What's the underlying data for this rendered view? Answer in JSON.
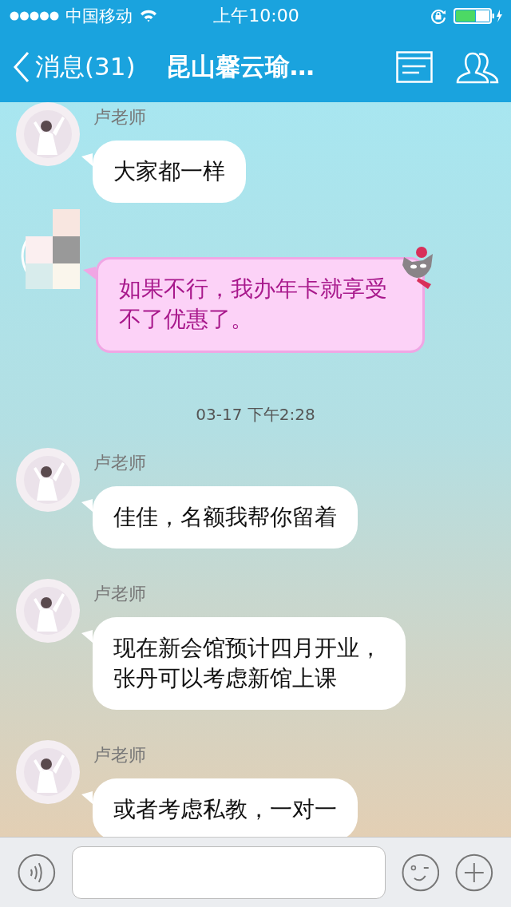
{
  "status_bar": {
    "carrier": "中国移动",
    "time": "上午10:00"
  },
  "nav": {
    "back_label": "消息(31)",
    "title": "昆山馨云瑜…"
  },
  "messages": [
    {
      "kind": "text",
      "sender": "卢老师",
      "text": "大家都一样"
    },
    {
      "kind": "pink",
      "text": "如果不行，我办年卡就享受不了优惠了。"
    },
    {
      "kind": "time",
      "text": "03-17 下午2:28"
    },
    {
      "kind": "text",
      "sender": "卢老师",
      "text": "佳佳，名额我帮你留着"
    },
    {
      "kind": "text",
      "sender": "卢老师",
      "text": "现在新会馆预计四月开业，张丹可以考虑新馆上课"
    },
    {
      "kind": "text",
      "sender": "卢老师",
      "text": "或者考虑私教，一对一"
    }
  ]
}
